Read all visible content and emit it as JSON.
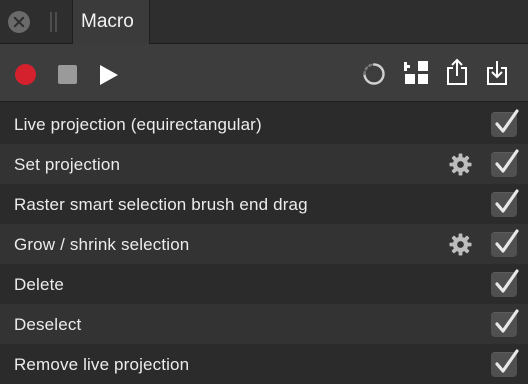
{
  "panel": {
    "tab_title": "Macro"
  },
  "toolbar": {
    "record": "record-icon",
    "stop": "stop-icon",
    "play": "play-icon",
    "spinner": "spinner-icon",
    "add": "add-grid-icon",
    "share": "share-icon",
    "import": "import-icon"
  },
  "colors": {
    "record": "#d5202e",
    "background": "#2b2b2b",
    "toolbar": "#3d3d3d"
  },
  "steps": [
    {
      "label": "Live projection (equirectangular)",
      "has_settings": false,
      "checked": true
    },
    {
      "label": "Set projection",
      "has_settings": true,
      "checked": true
    },
    {
      "label": "Raster smart selection brush end drag",
      "has_settings": false,
      "checked": true
    },
    {
      "label": "Grow / shrink selection",
      "has_settings": true,
      "checked": true
    },
    {
      "label": "Delete",
      "has_settings": false,
      "checked": true
    },
    {
      "label": "Deselect",
      "has_settings": false,
      "checked": true
    },
    {
      "label": "Remove live projection",
      "has_settings": false,
      "checked": true
    }
  ]
}
